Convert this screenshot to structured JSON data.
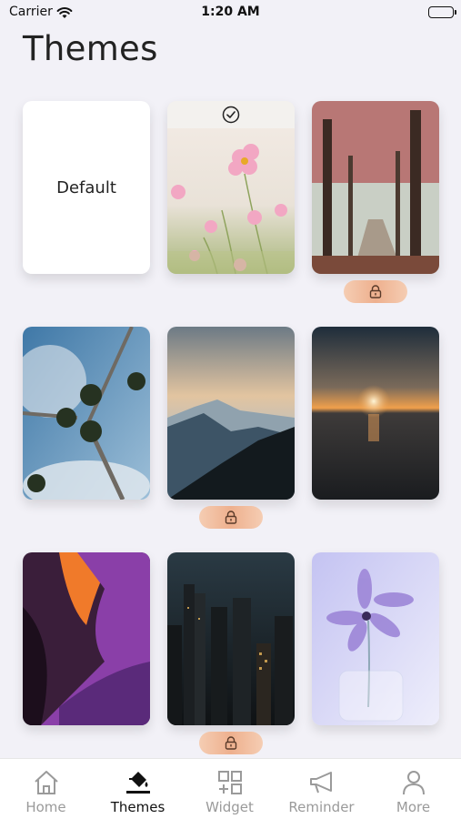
{
  "status_bar": {
    "carrier": "Carrier",
    "time": "1:20 AM"
  },
  "title": "Themes",
  "themes": [
    {
      "name": "Default",
      "label": "Default",
      "selected": false,
      "locked": false
    },
    {
      "name": "cosmos-flowers",
      "selected": true,
      "locked": false
    },
    {
      "name": "red-forest-path",
      "selected": false,
      "locked": true
    },
    {
      "name": "palm-trees",
      "selected": false,
      "locked": false
    },
    {
      "name": "mountain-sunset",
      "selected": false,
      "locked": true
    },
    {
      "name": "ocean-sunset",
      "selected": false,
      "locked": false
    },
    {
      "name": "purple-canyon",
      "selected": false,
      "locked": false
    },
    {
      "name": "night-city",
      "selected": false,
      "locked": true
    },
    {
      "name": "lilac-flower",
      "selected": false,
      "locked": false
    }
  ],
  "icons": {
    "selected": "check-circle-icon",
    "locked": "lock-icon"
  },
  "tab_bar": {
    "tabs": [
      {
        "label": "Home",
        "icon": "home-icon",
        "active": false
      },
      {
        "label": "Themes",
        "icon": "paint-bucket-icon",
        "active": true
      },
      {
        "label": "Widget",
        "icon": "widget-grid-icon",
        "active": false
      },
      {
        "label": "Reminder",
        "icon": "megaphone-icon",
        "active": false
      },
      {
        "label": "More",
        "icon": "person-icon",
        "active": false
      }
    ]
  },
  "colors": {
    "background": "#f2f1f7",
    "lock_badge": "#eeb08e",
    "active_tab": "#111111",
    "inactive_tab": "#9a9a9a"
  }
}
